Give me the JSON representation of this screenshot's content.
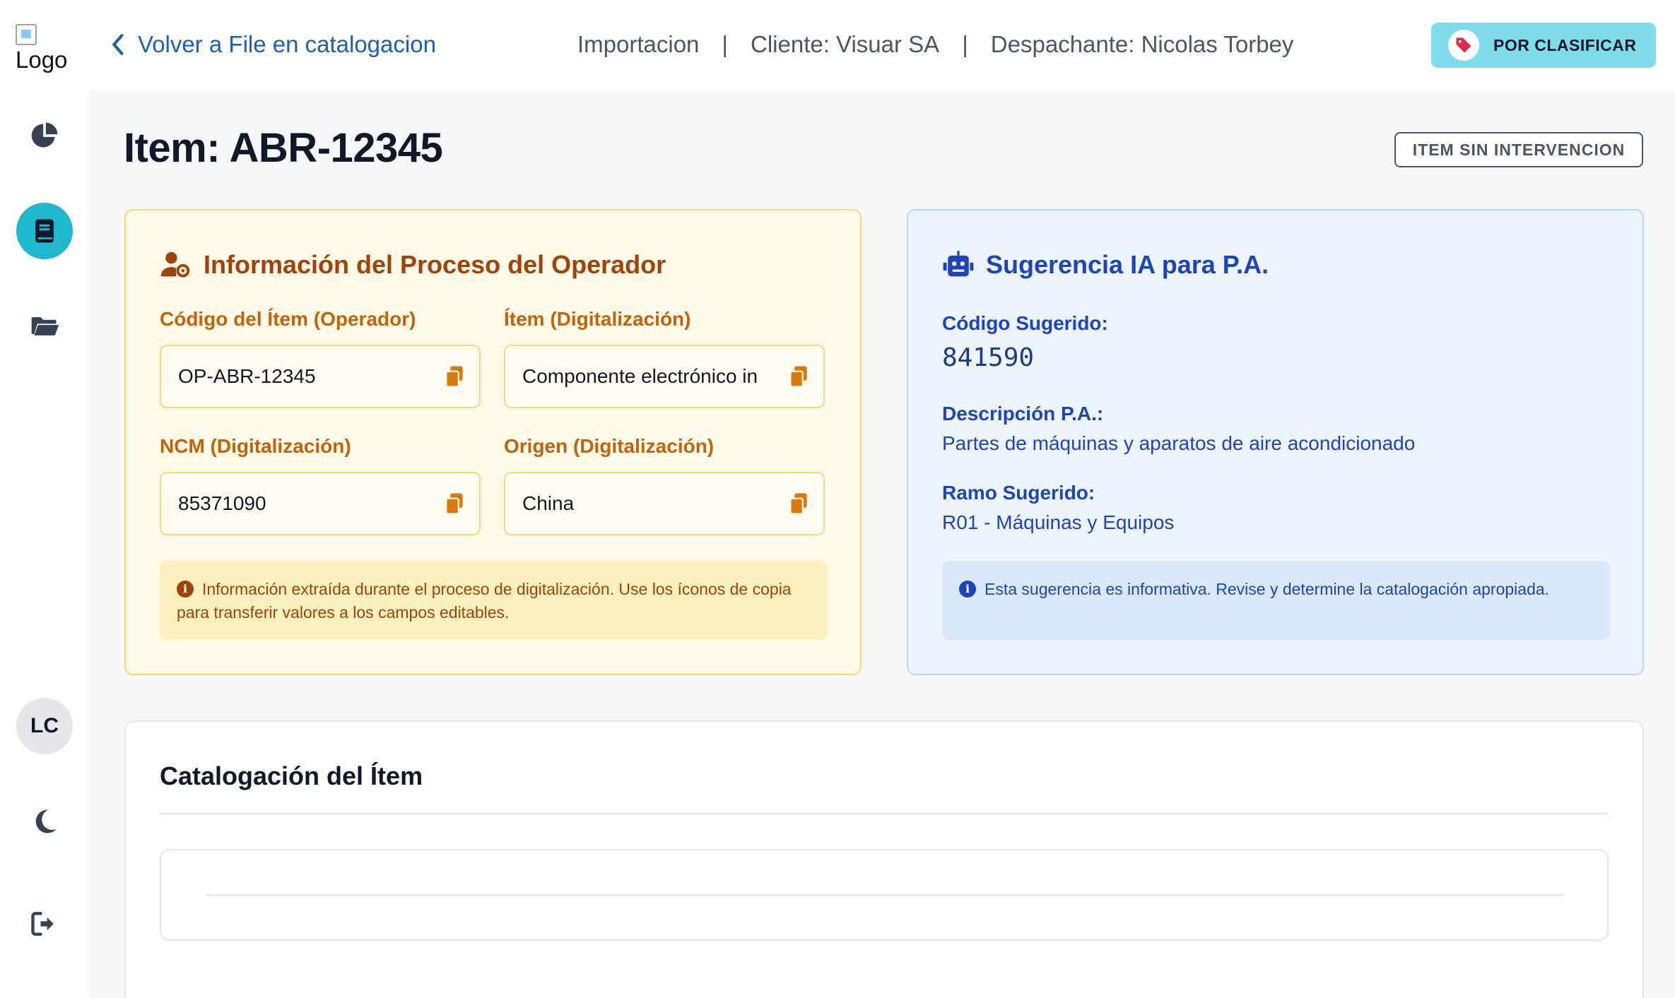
{
  "sidebar": {
    "logo_alt": "Logo",
    "nav_items": [
      {
        "icon": "pie-chart-icon"
      },
      {
        "icon": "book-icon",
        "active": true
      },
      {
        "icon": "folder-open-icon"
      }
    ],
    "avatar_initials": "LC",
    "bottom_icons": [
      "moon-icon",
      "logout-icon"
    ]
  },
  "header": {
    "back_label": "Volver a File en catalogacion",
    "meta": {
      "type": "Importacion",
      "separator": "|",
      "client": "Cliente: Visuar SA",
      "dispatcher": "Despachante: Nicolas Torbey"
    },
    "status_label": "POR CLASIFICAR"
  },
  "main": {
    "title": "Item: ABR-12345",
    "intervention_label": "ITEM SIN INTERVENCION",
    "operator_card": {
      "title": "Información del Proceso del Operador",
      "fields": [
        {
          "label": "Código del Ítem (Operador)",
          "value": "OP-ABR-12345"
        },
        {
          "label": "Ítem (Digitalización)",
          "value": "Componente electrónico in"
        },
        {
          "label": "NCM (Digitalización)",
          "value": "85371090"
        },
        {
          "label": "Origen (Digitalización)",
          "value": "China"
        }
      ],
      "note": "Información extraída durante el proceso de digitalización. Use los íconos de copia para transferir valores a los campos editables."
    },
    "ai_card": {
      "title": "Sugerencia IA para P.A.",
      "code_label": "Código Sugerido:",
      "code_value": "841590",
      "desc_label": "Descripción P.A.:",
      "desc_value": "Partes de máquinas y aparatos de aire acondicionado",
      "branch_label": "Ramo Sugerido:",
      "branch_value": "R01 - Máquinas y Equipos",
      "note": "Esta sugerencia es informativa. Revise y determine la catalogación apropiada."
    },
    "catalog": {
      "title": "Catalogación del Ítem"
    }
  },
  "colors": {
    "accent": "#1fb8cd",
    "status_pill": "#7fdcea",
    "operator_text": "#a0420b",
    "ai_text": "#1d44b8",
    "link": "#1d5fb0"
  }
}
